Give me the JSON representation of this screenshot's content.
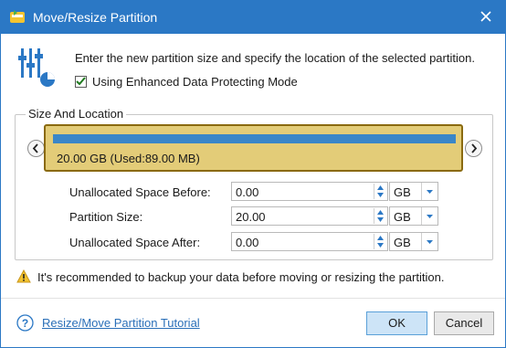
{
  "window": {
    "title": "Move/Resize Partition"
  },
  "intro": {
    "text": "Enter the new partition size and specify the location of the selected partition.",
    "checkbox_label": "Using Enhanced Data Protecting Mode",
    "checkbox_checked": true
  },
  "group": {
    "legend": "Size And Location",
    "partition_label": "20.00 GB (Used:89.00 MB)"
  },
  "fields": [
    {
      "label": "Unallocated Space Before:",
      "value": "0.00",
      "unit": "GB"
    },
    {
      "label": "Partition Size:",
      "value": "20.00",
      "unit": "GB"
    },
    {
      "label": "Unallocated Space After:",
      "value": "0.00",
      "unit": "GB"
    }
  ],
  "warning": {
    "text": "It's recommended to backup your data before moving or resizing the partition."
  },
  "footer": {
    "tutorial_link": "Resize/Move Partition Tutorial",
    "ok_label": "OK",
    "cancel_label": "Cancel"
  },
  "colors": {
    "titlebar": "#2b78c5",
    "partition_fill": "#e3cc78",
    "used_bar": "#3a86c8",
    "link": "#2a6fb8"
  },
  "icons": [
    "app-icon",
    "close-icon",
    "resize-sliders-icon",
    "checkmark-icon",
    "chevron-left-icon",
    "chevron-right-icon",
    "spin-up-icon",
    "spin-down-icon",
    "dropdown-arrow-icon",
    "warning-icon",
    "help-icon"
  ]
}
